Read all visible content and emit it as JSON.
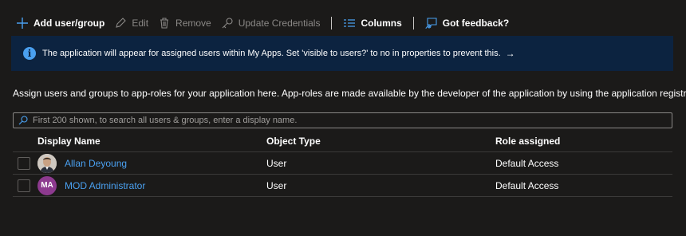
{
  "toolbar": {
    "add_label": "Add user/group",
    "edit_label": "Edit",
    "remove_label": "Remove",
    "update_label": "Update Credentials",
    "columns_label": "Columns",
    "feedback_label": "Got feedback?"
  },
  "banner": {
    "message": "The application will appear for assigned users within My Apps. Set 'visible to users?' to no in properties to prevent this.",
    "arrow": "→"
  },
  "description": "Assign users and groups to app-roles for your application here. App-roles are made available by the developer of the application by using the application registration.",
  "search": {
    "placeholder": "First 200 shown, to search all users & groups, enter a display name."
  },
  "table": {
    "headers": {
      "display_name": "Display Name",
      "object_type": "Object Type",
      "role_assigned": "Role assigned"
    },
    "rows": [
      {
        "name": "Allan Deyoung",
        "type": "User",
        "role": "Default Access",
        "avatar": "photo"
      },
      {
        "name": "MOD Administrator",
        "type": "User",
        "role": "Default Access",
        "avatar": "MA"
      }
    ]
  },
  "colors": {
    "background": "#1b1a19",
    "banner": "#0c2340",
    "accent": "#4aa0f0",
    "avatar_ma": "#8d3a8f"
  }
}
